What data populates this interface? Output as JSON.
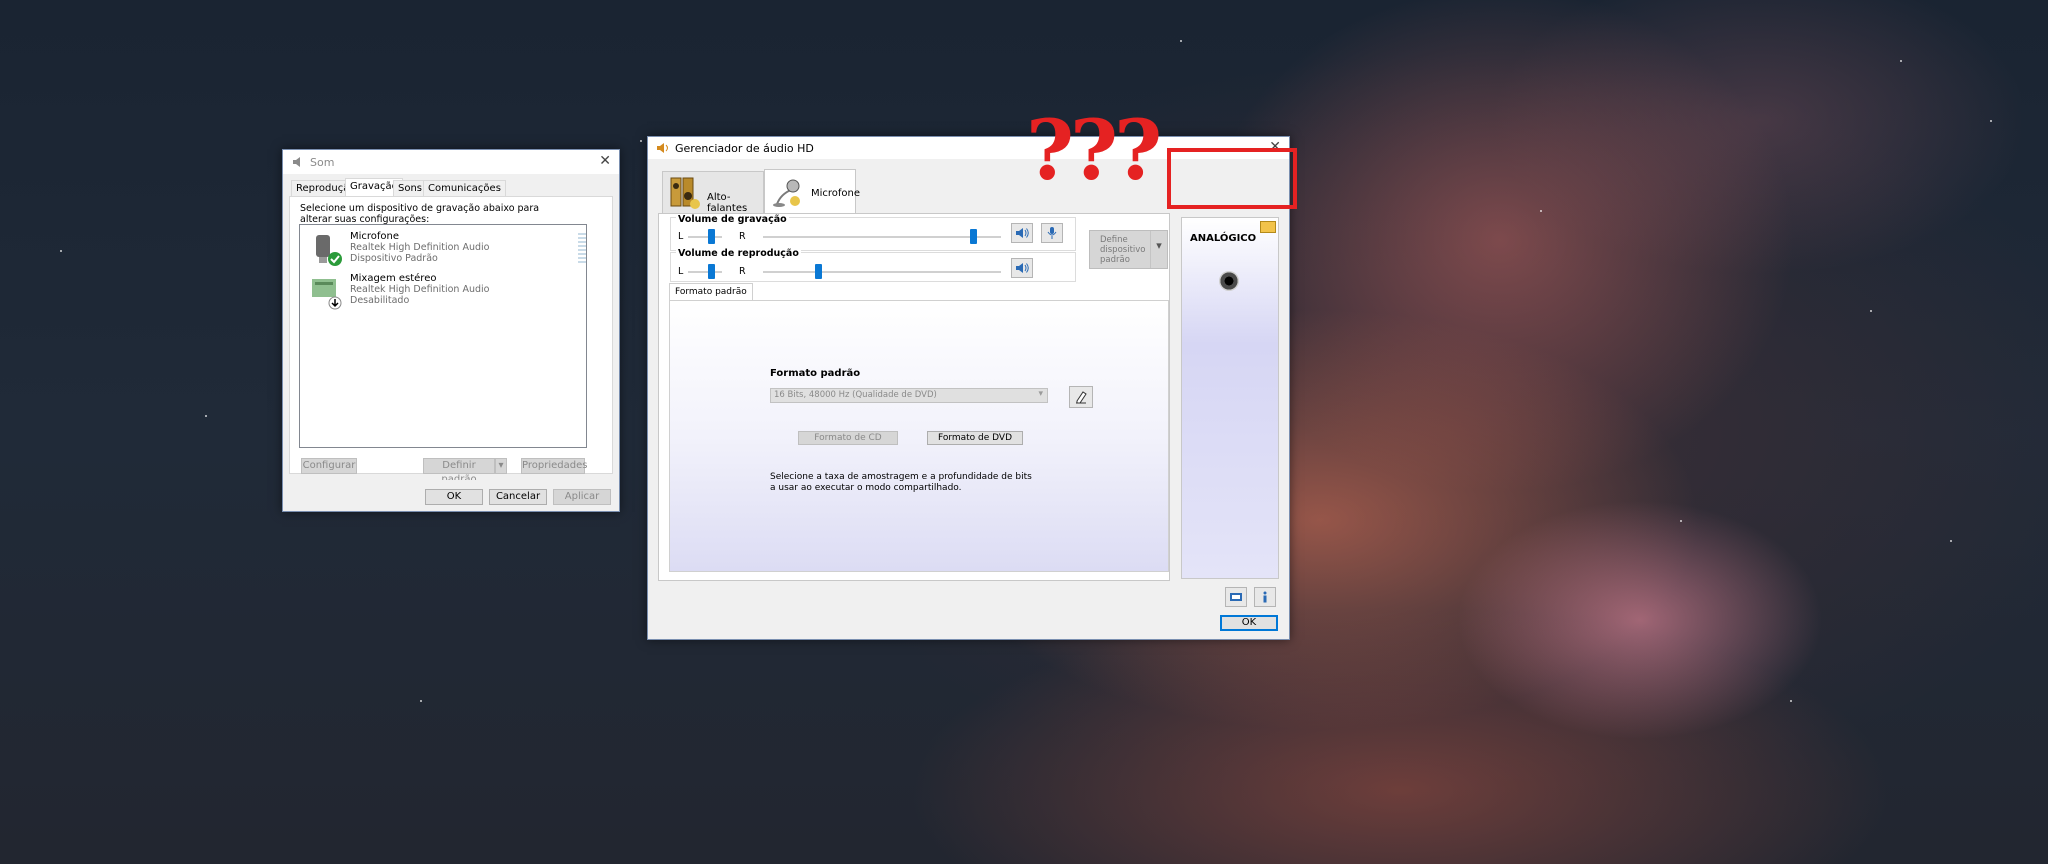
{
  "som": {
    "title": "Som",
    "tabs": [
      "Reprodução",
      "Gravação",
      "Sons",
      "Comunicações"
    ],
    "instruction": "Selecione um dispositivo de gravação abaixo para alterar suas configurações:",
    "devices": [
      {
        "name": "Microfone",
        "driver": "Realtek High Definition Audio",
        "status": "Dispositivo Padrão"
      },
      {
        "name": "Mixagem estéreo",
        "driver": "Realtek High Definition Audio",
        "status": "Desabilitado"
      }
    ],
    "buttons": {
      "configurar": "Configurar",
      "definir": "Definir padrão",
      "propriedades": "Propriedades",
      "ok": "OK",
      "cancelar": "Cancelar",
      "aplicar": "Aplicar"
    }
  },
  "hd": {
    "title": "Gerenciador de áudio HD",
    "tabs": [
      "Alto-falantes",
      "Microfone"
    ],
    "recording_volume": "Volume de gravação",
    "playback_volume": "Volume de reprodução",
    "l": "L",
    "r": "R",
    "define_device": "Define dispositivo padrão",
    "format_tab": "Formato padrão",
    "format_heading": "Formato padrão",
    "format_value": "16 Bits, 48000 Hz (Qualidade de DVD)",
    "cd_button": "Formato de CD",
    "dvd_button": "Formato de DVD",
    "description": "Selecione a taxa de amostragem e a profundidade de bits a usar ao executar o modo compartilhado.",
    "analog": "ANALÓGICO",
    "ok": "OK"
  },
  "annotation": {
    "marks": "???",
    "color": "#e52222"
  }
}
